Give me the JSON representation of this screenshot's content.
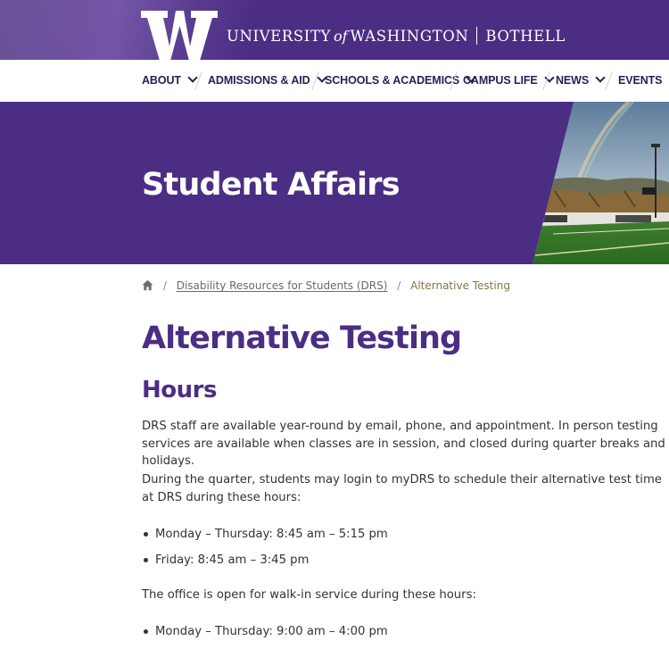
{
  "header": {
    "logo_letter": "W",
    "brand_name": "UNIVERSITY",
    "brand_of": "of",
    "brand_place": "WASHINGTON",
    "campus": "BOTHELL",
    "colors": {
      "purple": "#4b2e83",
      "gold": "#85754d"
    }
  },
  "nav": {
    "items": [
      {
        "label": "ABOUT",
        "icon": "chevron-down-icon"
      },
      {
        "label": "ADMISSIONS & AID",
        "icon": "chevron-down-icon"
      },
      {
        "label": "SCHOOLS & ACADEMICS",
        "icon": "chevron-down-icon"
      },
      {
        "label": "CAMPUS LIFE",
        "icon": "chevron-down-icon"
      },
      {
        "label": "NEWS",
        "icon": "chevron-down-icon"
      },
      {
        "label": "EVENTS"
      }
    ]
  },
  "hero": {
    "title": "Student Affairs"
  },
  "breadcrumb": {
    "home_icon": "home-icon",
    "separator": "/",
    "items": [
      {
        "label": "Disability Resources for Students (DRS)"
      },
      {
        "label": "Alternative Testing"
      }
    ]
  },
  "main": {
    "title": "Alternative Testing",
    "section_heading": "Hours",
    "paragraphs": [
      "DRS staff are available year-round by email, phone, and appointment. In person testing services are available when classes are in session, and closed during quarter breaks and holidays.",
      "During the quarter, students may login to myDRS to schedule their alternative test time at DRS during these hours:",
      "The office is open for walk-in service during these hours:"
    ],
    "testing_hours": [
      "Monday – Thursday: 8:45 am – 5:15 pm",
      "Friday: 8:45 am – 3:45 pm"
    ],
    "walkin_hours": [
      "Monday – Thursday: 9:00 am – 4:00 pm"
    ]
  }
}
